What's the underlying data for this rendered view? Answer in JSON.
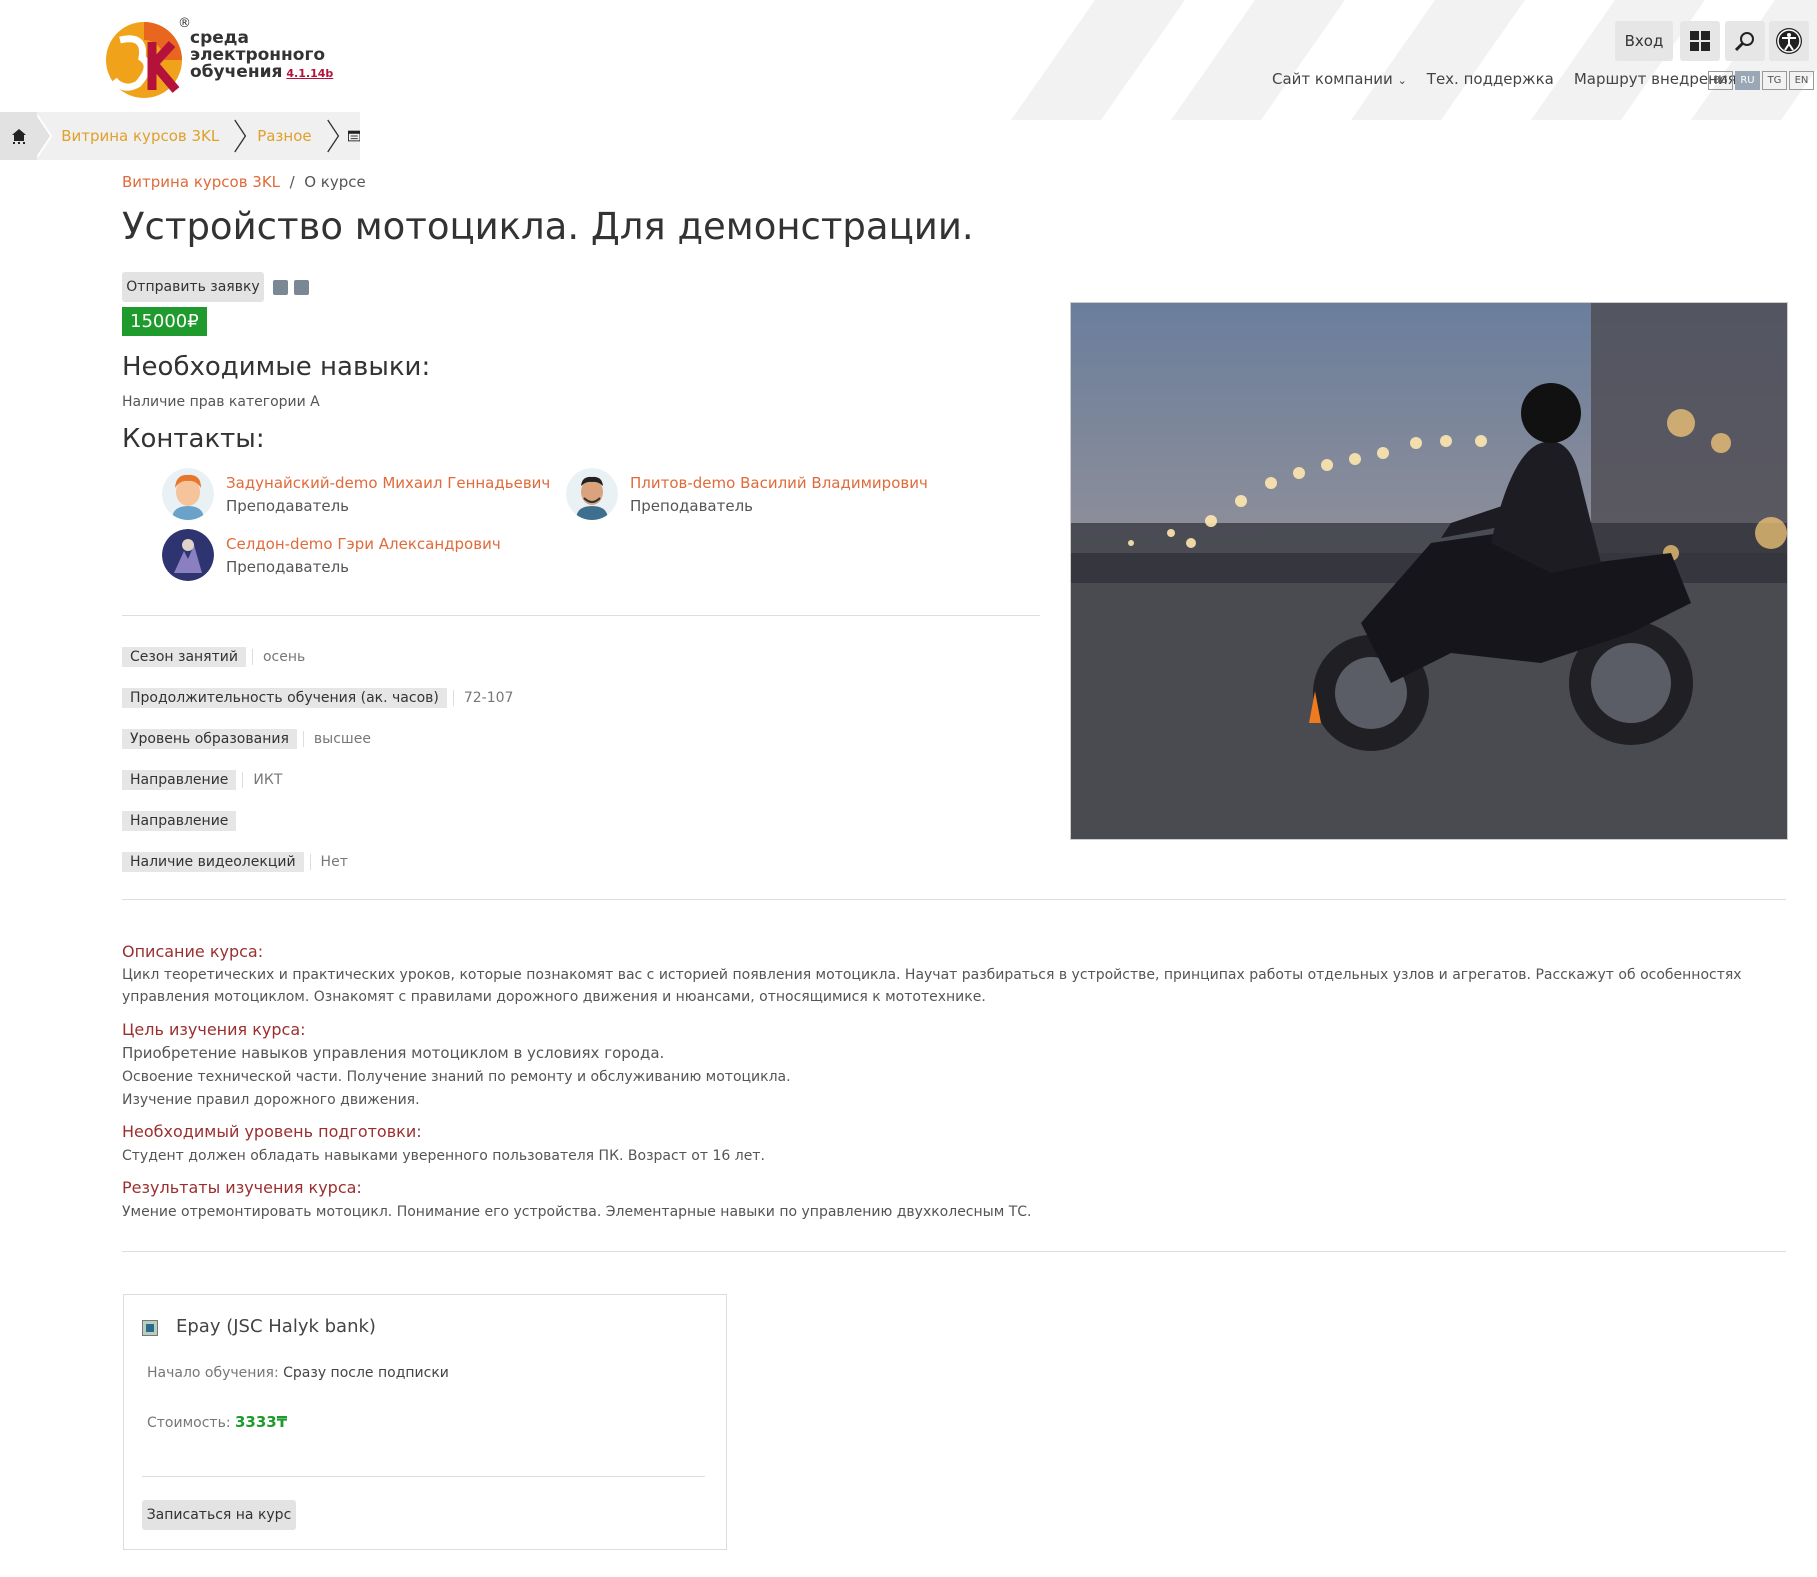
{
  "logo": {
    "line1": "среда",
    "line2": "электронного",
    "line3": "обучения",
    "version": "4.1.14b",
    "reg": "®"
  },
  "header": {
    "login_label": "Вход",
    "nav": [
      "Сайт компании",
      "Тех. поддержка",
      "Маршрут внедрения"
    ],
    "langs": [
      "BG",
      "RU",
      "TG",
      "EN"
    ],
    "active_lang": "RU"
  },
  "breadcrumb": {
    "items": [
      "Витрина курсов 3KL",
      "Разное"
    ]
  },
  "subcrumb": {
    "link": "Витрина курсов 3KL",
    "sep": "/",
    "current": "О курсе"
  },
  "course": {
    "title": "Устройство мотоцикла. Для демонстрации.",
    "apply_label": "Отправить заявку",
    "price": "15000₽",
    "skills_heading": "Необходимые навыки:",
    "skills_text": "Наличие прав категории А",
    "contacts_heading": "Контакты:"
  },
  "contacts": [
    {
      "name": "Задунайский-demo Михаил Геннадьевич",
      "role": "Преподаватель"
    },
    {
      "name": "Плитов-demo Василий Владимирович",
      "role": "Преподаватель"
    },
    {
      "name": "Селдон-demo Гэри Александрович",
      "role": "Преподаватель"
    }
  ],
  "attributes": [
    {
      "key": "Сезон занятий",
      "value": "осень"
    },
    {
      "key": "Продолжительность обучения (ак. часов)",
      "value": "72-107"
    },
    {
      "key": "Уровень образования",
      "value": "высшее"
    },
    {
      "key": "Направление",
      "value": "ИКТ"
    },
    {
      "key": "Направление",
      "value": ""
    },
    {
      "key": "Наличие видеолекций",
      "value": "Нет"
    }
  ],
  "description": {
    "h1": "Описание курса:",
    "t1": "Цикл теоретических и практических уроков, которые познакомят вас с историей появления мотоцикла. Научат разбираться в устройстве, принципах работы отдельных узлов и агрегатов. Расскажут об особенностях управления мотоциклом.  Ознакомят с правилами дорожного движения и нюансами, относящимися к мототехнике.",
    "h2": "Цель изучения курса:",
    "t2a": "Приобретение навыков управления мотоциклом в условиях города.",
    "t2b": "Освоение технической части. Получение знаний по ремонту и обслуживанию мотоцикла.",
    "t2c": "Изучение правил дорожного движения.",
    "h3": "Необходимый уровень подготовки:",
    "t3": "Студент должен обладать навыками уверенного пользователя ПК. Возраст от 16 лет.",
    "h4": "Результаты изучения курса:",
    "t4": "Умение отремонтировать мотоцикл. Понимание его устройства. Элементарные навыки по управлению двухколесным ТС."
  },
  "payment": {
    "title": "Epay (JSC Halyk bank)",
    "start_label": "Начало обучения:",
    "start_value": "Сразу после подписки",
    "cost_label": "Стоимость:",
    "cost_value": "3333₸",
    "enroll_label": "Записаться на курс"
  }
}
